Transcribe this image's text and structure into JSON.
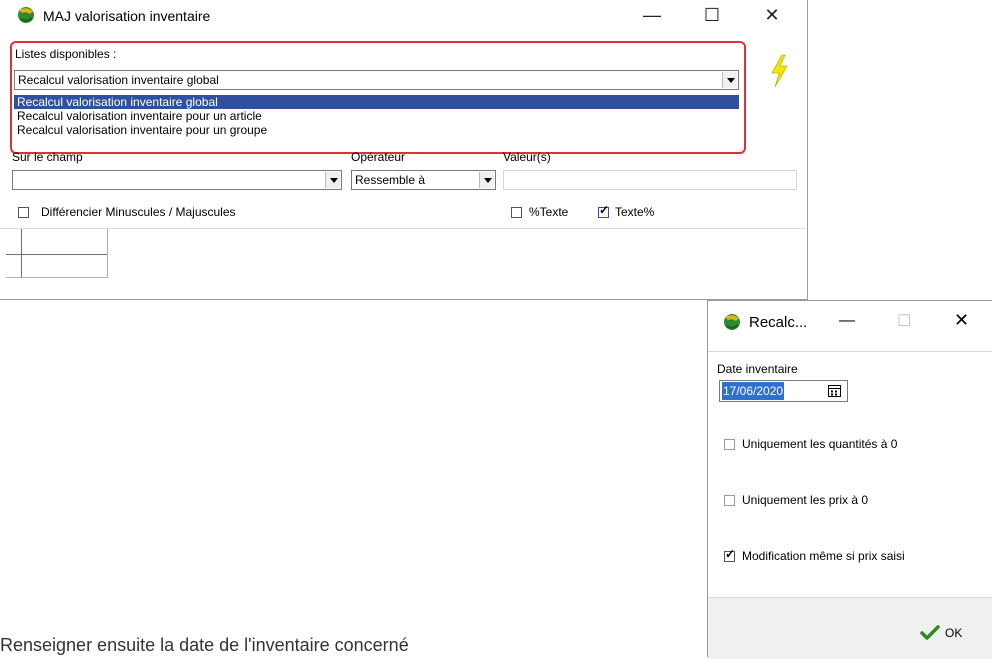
{
  "main_window": {
    "title": "MAJ valorisation inventaire",
    "minimize": "—",
    "maximize": "☐",
    "close": "✕",
    "lists_label": "Listes disponibles :",
    "selected_list": "Recalcul valorisation inventaire global",
    "list_options": [
      "Recalcul valorisation inventaire global",
      "Recalcul valorisation inventaire pour un article",
      "Recalcul valorisation inventaire pour un groupe"
    ],
    "field_label": "Sur le champ",
    "field_value": "",
    "operator_label": "Opérateur",
    "operator_value": "Ressemble à",
    "values_label": "Valeur(s)",
    "values_value": "",
    "case_checkbox_label": "Différencier Minuscules / Majuscules",
    "case_checked": false,
    "pct_text_label": "%Texte",
    "pct_text_checked": false,
    "text_pct_label": "Texte%",
    "text_pct_checked": true,
    "highlight_color": "#e0303a"
  },
  "dialog": {
    "title": "Recalc...",
    "minimize": "—",
    "maximize": "☐",
    "close": "✕",
    "date_label": "Date inventaire",
    "date_value": "17/06/2020",
    "opt1_label": "Uniquement les quantités à 0",
    "opt1_checked": false,
    "opt2_label": "Uniquement les prix à 0",
    "opt2_checked": false,
    "opt3_label": "Modification même si prix saisi",
    "opt3_checked": true,
    "ok_label": "OK"
  },
  "caption": "Renseigner ensuite la date de l'inventaire concerné"
}
